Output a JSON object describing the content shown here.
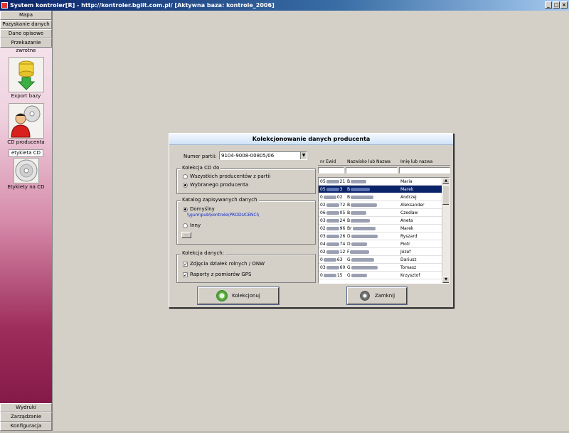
{
  "window": {
    "title": "System kontroler[R] - http://kontroler.bgiit.com.pl/ [Aktywna baza: kontrole_2006]",
    "buttons": [
      "_",
      "□",
      "×"
    ]
  },
  "sidebar": {
    "top_items": [
      {
        "label": "Mapa"
      },
      {
        "label": "Pozyskanie danych"
      },
      {
        "label": "Dane opisowe"
      },
      {
        "label": "Przekazanie zwrotne"
      }
    ],
    "tools": [
      {
        "label": "Export bazy",
        "icon": "database-export-icon"
      },
      {
        "label": "CD producenta",
        "icon": "cd-person-icon"
      },
      {
        "tag": "etykieta CD",
        "label": "Etykiety na CD",
        "icon": "cd-label-icon"
      }
    ],
    "bottom_items": [
      {
        "label": "Wydruki"
      },
      {
        "label": "Zarządzanie"
      },
      {
        "label": "Konfiguracja"
      }
    ]
  },
  "dialog": {
    "title": "Kolekcjonowanie danych producenta",
    "party_label": "Numer partii:",
    "party_value": "9104-9008-00805/06",
    "cd_group": {
      "caption": "Kolekcja CD do",
      "options": [
        "Wszystkich producentów z partii",
        "Wybranego producenta"
      ],
      "selected": 1
    },
    "catalog_group": {
      "caption": "Katalog zapisywanych danych",
      "default_label": "Domyślny",
      "path": "\\\\gum\\pub\\kontrole\\PRODUCENCI\\",
      "other_label": "Inny",
      "browse_label": "..."
    },
    "collection_group": {
      "caption": "Kolekcja  danych:",
      "items": [
        {
          "label": "Zdjęcia działek rolnych / ONW",
          "checked": true
        },
        {
          "label": "Raporty z pomiarów GPS",
          "checked": true
        }
      ]
    },
    "table": {
      "headers": [
        "nr Ewid",
        "Nazwisko lub Nazwa",
        "Imię lub nazwa"
      ],
      "rows": [
        {
          "id_start": "05",
          "id_end": "21",
          "surname_start": "B",
          "name": "Maria",
          "selected": false
        },
        {
          "id_start": "05",
          "id_end": "3",
          "surname_start": "B",
          "name": "Marek",
          "selected": true
        },
        {
          "id_start": "0",
          "id_end": "02",
          "surname_start": "B",
          "name": "Andrzej",
          "selected": false
        },
        {
          "id_start": "02",
          "id_end": "72",
          "surname_start": "B",
          "name": "Aleksander",
          "selected": false
        },
        {
          "id_start": "06",
          "id_end": "05",
          "surname_start": "B",
          "name": "Czesław",
          "selected": false
        },
        {
          "id_start": "03",
          "id_end": "24",
          "surname_start": "B",
          "name": "Aneta",
          "selected": false
        },
        {
          "id_start": "02",
          "id_end": "96",
          "surname_start": "Br",
          "name": "Marek",
          "selected": false
        },
        {
          "id_start": "03",
          "id_end": "26",
          "surname_start": "D",
          "name": "Ryszard",
          "selected": false
        },
        {
          "id_start": "04",
          "id_end": "74",
          "surname_start": "D",
          "name": "Piotr",
          "selected": false
        },
        {
          "id_start": "02",
          "id_end": "12",
          "surname_start": "F",
          "name": "Józef",
          "selected": false
        },
        {
          "id_start": "0",
          "id_end": "63",
          "surname_start": "G",
          "name": "Dariusz",
          "selected": false
        },
        {
          "id_start": "03",
          "id_end": "60",
          "surname_start": "G",
          "name": "Tomasz",
          "selected": false
        },
        {
          "id_start": "0",
          "id_end": "15",
          "surname_start": "G",
          "name": "Krzysztof",
          "selected": false
        }
      ]
    },
    "collect_button": "Kolekcjonuj",
    "close_button": "Zamknij"
  }
}
